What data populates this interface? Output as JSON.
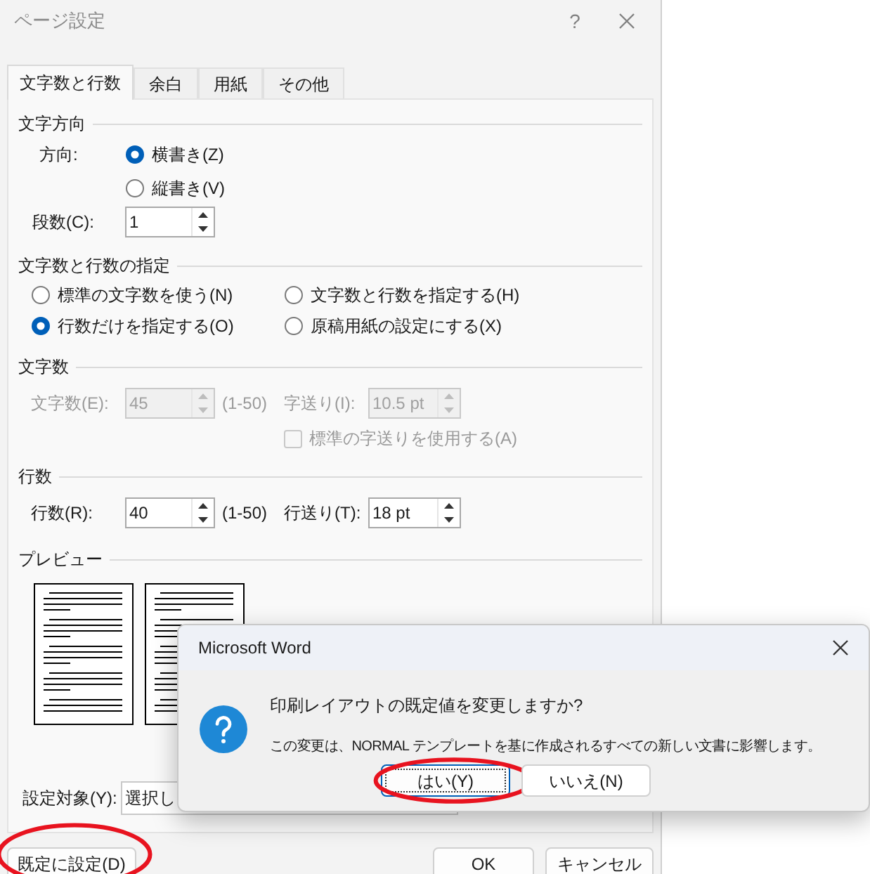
{
  "window": {
    "title": "ページ設定",
    "help": "?"
  },
  "tabs": [
    {
      "label": "文字数と行数",
      "selected": true
    },
    {
      "label": "余白",
      "selected": false
    },
    {
      "label": "用紙",
      "selected": false
    },
    {
      "label": "その他",
      "selected": false
    }
  ],
  "text_direction": {
    "heading": "文字方向",
    "direction_label": "方向:",
    "options": [
      {
        "label": "横書き(Z)",
        "selected": true
      },
      {
        "label": "縦書き(V)",
        "selected": false
      }
    ],
    "columns_label": "段数(C):",
    "columns_value": "1"
  },
  "grid": {
    "heading": "文字数と行数の指定",
    "options": [
      {
        "label": "標準の文字数を使う(N)",
        "selected": false
      },
      {
        "label": "文字数と行数を指定する(H)",
        "selected": false
      },
      {
        "label": "行数だけを指定する(O)",
        "selected": true
      },
      {
        "label": "原稿用紙の設定にする(X)",
        "selected": false
      }
    ]
  },
  "characters": {
    "heading": "文字数",
    "count_label": "文字数(E):",
    "count_value": "45",
    "count_range": "(1-50)",
    "pitch_label": "字送り(I):",
    "pitch_value": "10.5 pt",
    "disabled": true,
    "default_pitch": {
      "label": "標準の字送りを使用する(A)",
      "checked": false,
      "disabled": true
    }
  },
  "lines": {
    "heading": "行数",
    "count_label": "行数(R):",
    "count_value": "40",
    "count_range": "(1-50)",
    "pitch_label": "行送り(T):",
    "pitch_value": "18 pt",
    "disabled": false
  },
  "preview": {
    "heading": "プレビュー"
  },
  "apply_to": {
    "label": "設定対象(Y):",
    "value": "選択し"
  },
  "buttons": [
    {
      "label": "既定に設定(D)",
      "circled": true
    },
    {
      "label": "OK",
      "circled": false
    },
    {
      "label": "キャンセル",
      "circled": false
    }
  ],
  "message_box": {
    "title": "Microsoft Word",
    "question": "印刷レイアウトの既定値を変更しますか?",
    "detail": "この変更は、NORMAL テンプレートを基に作成されるすべての新しい文書に影響します。",
    "buttons": [
      {
        "label": "はい(Y)",
        "default": true,
        "circled": true
      },
      {
        "label": "いいえ(N)",
        "default": false,
        "circled": false
      }
    ]
  }
}
